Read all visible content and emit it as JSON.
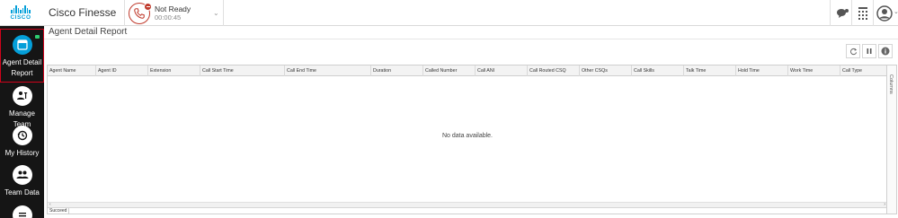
{
  "header": {
    "logo_text": "CISCO",
    "app_title": "Cisco Finesse",
    "agent_state": {
      "label": "Not Ready",
      "timer": "00:00:45"
    }
  },
  "nav": {
    "items": [
      {
        "label": "Agent Detail Report",
        "icon": "report-icon",
        "active": true
      },
      {
        "label": "Manage Team",
        "icon": "manage-team-icon",
        "active": false
      },
      {
        "label": "My History",
        "icon": "history-icon",
        "active": false
      },
      {
        "label": "Team Data",
        "icon": "team-data-icon",
        "active": false
      }
    ]
  },
  "gadget": {
    "title": "Agent Detail Report",
    "columns": [
      "Agent Name",
      "Agent ID",
      "Extension",
      "Call Start Time",
      "Call End Time",
      "Duration",
      "Called Number",
      "Call ANI",
      "Call Routed CSQ",
      "Other CSQs",
      "Call Skills",
      "Talk Time",
      "Hold Time",
      "Work Time",
      "Call Type"
    ],
    "empty_message": "No data available.",
    "side_tab_label": "Columns",
    "status_text": "Succeed"
  },
  "colors": {
    "brand": "#049fd9",
    "not_ready": "#c0392b",
    "nav_bg": "#151515",
    "active_border": "#d0021b"
  }
}
